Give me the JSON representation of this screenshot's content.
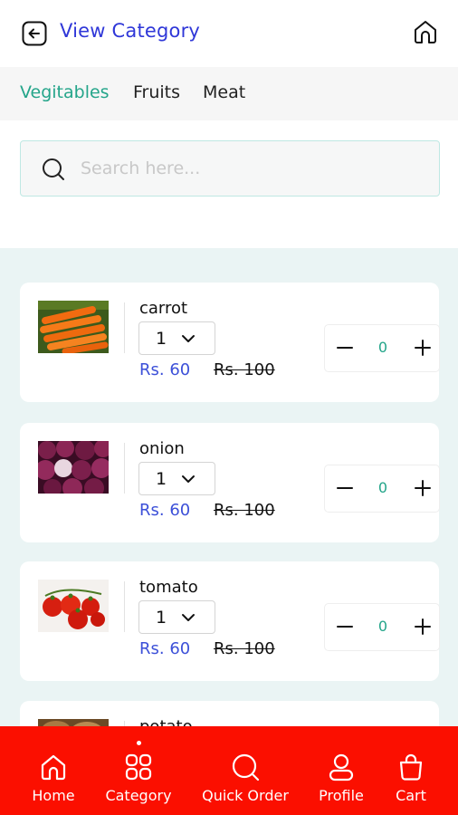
{
  "header": {
    "title": "View Category"
  },
  "tabs": [
    {
      "label": "Vegitables",
      "active": true
    },
    {
      "label": "Fruits",
      "active": false
    },
    {
      "label": "Meat",
      "active": false
    }
  ],
  "search": {
    "placeholder": "Search here...",
    "value": ""
  },
  "products": [
    {
      "name": "carrot",
      "qty_option": "1",
      "price": "Rs. 60",
      "mrp": "Rs. 100",
      "count": "0",
      "image": "carrot-image"
    },
    {
      "name": "onion",
      "qty_option": "1",
      "price": "Rs. 60",
      "mrp": "Rs. 100",
      "count": "0",
      "image": "onion-image"
    },
    {
      "name": "tomato",
      "qty_option": "1",
      "price": "Rs. 60",
      "mrp": "Rs. 100",
      "count": "0",
      "image": "tomato-image"
    },
    {
      "name": "potato",
      "image": "potato-image"
    }
  ],
  "bottom_nav": [
    {
      "label": "Home",
      "icon": "home-icon"
    },
    {
      "label": "Category",
      "icon": "category-icon",
      "active": true
    },
    {
      "label": "Quick Order",
      "icon": "search-icon"
    },
    {
      "label": "Profile",
      "icon": "profile-icon"
    },
    {
      "label": "Cart",
      "icon": "cart-icon"
    }
  ],
  "colors": {
    "accent_blue": "#2f37d8",
    "accent_teal": "#24a58a",
    "price_blue": "#3c50d8",
    "nav_red": "#fb0f00",
    "list_bg": "#eaf4f4"
  }
}
